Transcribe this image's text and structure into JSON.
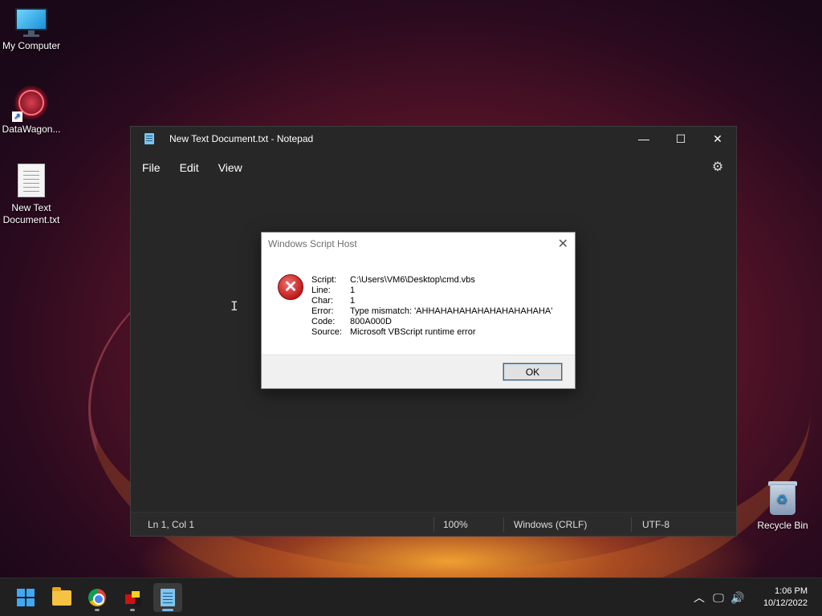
{
  "desktop": {
    "icons": [
      {
        "label": "My Computer",
        "icon": "monitor-icon"
      },
      {
        "label": "DataWagon...",
        "icon": "datawagon-shortcut-icon"
      },
      {
        "label": "New Text Document.txt",
        "icon": "text-document-icon"
      },
      {
        "label": "Recycle Bin",
        "icon": "recycle-bin-icon"
      }
    ]
  },
  "notepad": {
    "title": "New Text Document.txt - Notepad",
    "menu": [
      "File",
      "Edit",
      "View"
    ],
    "controls": {
      "minimize": "—",
      "maximize": "☐",
      "close": "✕"
    },
    "status": {
      "position": "Ln 1, Col 1",
      "zoom": "100%",
      "line_ending": "Windows (CRLF)",
      "encoding": "UTF-8"
    }
  },
  "dialog": {
    "title": "Windows Script Host",
    "rows": [
      {
        "key": "Script:",
        "value": "C:\\Users\\VM6\\Desktop\\cmd.vbs"
      },
      {
        "key": "Line:",
        "value": "1"
      },
      {
        "key": "Char:",
        "value": "1"
      },
      {
        "key": "Error:",
        "value": "Type mismatch: 'AHHAHAHAHAHAHAHAHAHAHA'"
      },
      {
        "key": "Code:",
        "value": "800A000D"
      },
      {
        "key": "Source:",
        "value": "Microsoft VBScript runtime error"
      }
    ],
    "ok_label": "OK"
  },
  "taskbar": {
    "apps": [
      "start-icon",
      "file-explorer-icon",
      "chrome-icon",
      "tool-app-icon",
      "notepad-icon"
    ],
    "clock": {
      "time": "1:06 PM",
      "date": "10/12/2022"
    }
  }
}
